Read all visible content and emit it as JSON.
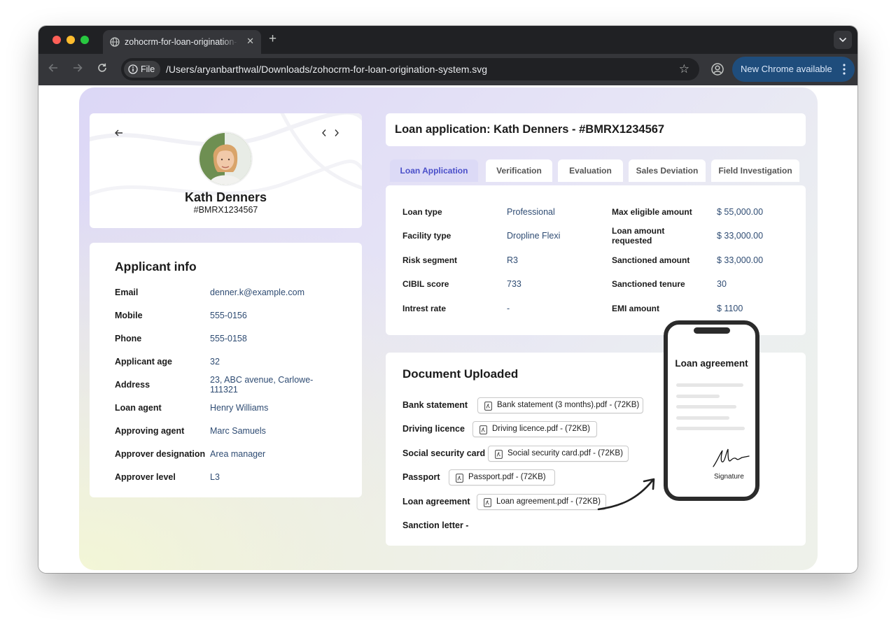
{
  "browser": {
    "tab_title": "zohocrm-for-loan-origination-system.svg",
    "scheme_chip": "File",
    "url": "/Users/aryanbarthwal/Downloads/zohocrm-for-loan-origination-system.svg",
    "update_button": "New Chrome available",
    "icons": [
      "globe-icon",
      "close-icon",
      "plus-icon",
      "chevron-down-icon",
      "back-icon",
      "forward-icon",
      "reload-icon",
      "info-icon",
      "star-icon",
      "profile-icon",
      "kebab-icon"
    ]
  },
  "profile": {
    "name": "Kath Denners",
    "id": "#BMRX1234567"
  },
  "applicant": {
    "title": "Applicant info",
    "rows": [
      {
        "label": "Email",
        "value": "denner.k@example.com"
      },
      {
        "label": "Mobile",
        "value": "555-0156"
      },
      {
        "label": "Phone",
        "value": "555-0158"
      },
      {
        "label": "Applicant age",
        "value": "32"
      },
      {
        "label": "Address",
        "value": "23, ABC avenue, Carlowe-111321"
      },
      {
        "label": "Loan agent",
        "value": "Henry Williams"
      },
      {
        "label": "Approving agent",
        "value": "Marc Samuels"
      },
      {
        "label": "Approver designation",
        "value": "Area manager"
      },
      {
        "label": "Approver level",
        "value": "L3"
      }
    ]
  },
  "application": {
    "title": "Loan application: Kath Denners - #BMRX1234567",
    "tabs": [
      "Loan Application",
      "Verification",
      "Evaluation",
      "Sales Deviation",
      "Field Investigation"
    ],
    "active_tab": "Loan Application",
    "left_fields": [
      {
        "label": "Loan type",
        "value": "Professional"
      },
      {
        "label": "Facility type",
        "value": "Dropline Flexi"
      },
      {
        "label": "Risk segment",
        "value": "R3"
      },
      {
        "label": "CIBIL score",
        "value": "733"
      },
      {
        "label": "Intrest rate",
        "value": "-"
      }
    ],
    "right_fields": [
      {
        "label": "Max eligible amount",
        "value": "$ 55,000.00"
      },
      {
        "label": "Loan amount requested",
        "value": "$ 33,000.00"
      },
      {
        "label": "Sanctioned amount",
        "value": "$ 33,000.00"
      },
      {
        "label": "Sanctioned tenure",
        "value": "30"
      },
      {
        "label": "EMI amount",
        "value": "$ 1100"
      }
    ]
  },
  "documents": {
    "title": "Document Uploaded",
    "rows": [
      {
        "label": "Bank statement",
        "file": "Bank statement (3 months).pdf - (72KB)"
      },
      {
        "label": "Driving licence",
        "file": "Driving licence.pdf - (72KB)"
      },
      {
        "label": "Social security card",
        "file": "Social security card.pdf - (72KB)"
      },
      {
        "label": "Passport",
        "file": "Passport.pdf - (72KB)"
      },
      {
        "label": "Loan agreement",
        "file": "Loan agreement.pdf - (72KB)"
      },
      {
        "label": "Sanction letter -",
        "file": ""
      }
    ]
  },
  "phone_preview": {
    "title": "Loan agreement",
    "signature_label": "Signature"
  },
  "colors": {
    "accent": "#4a4fc9",
    "value_text": "#2f4c73",
    "active_tab_bg": "#dcdaf6",
    "chrome_update": "#1f4d7c"
  }
}
